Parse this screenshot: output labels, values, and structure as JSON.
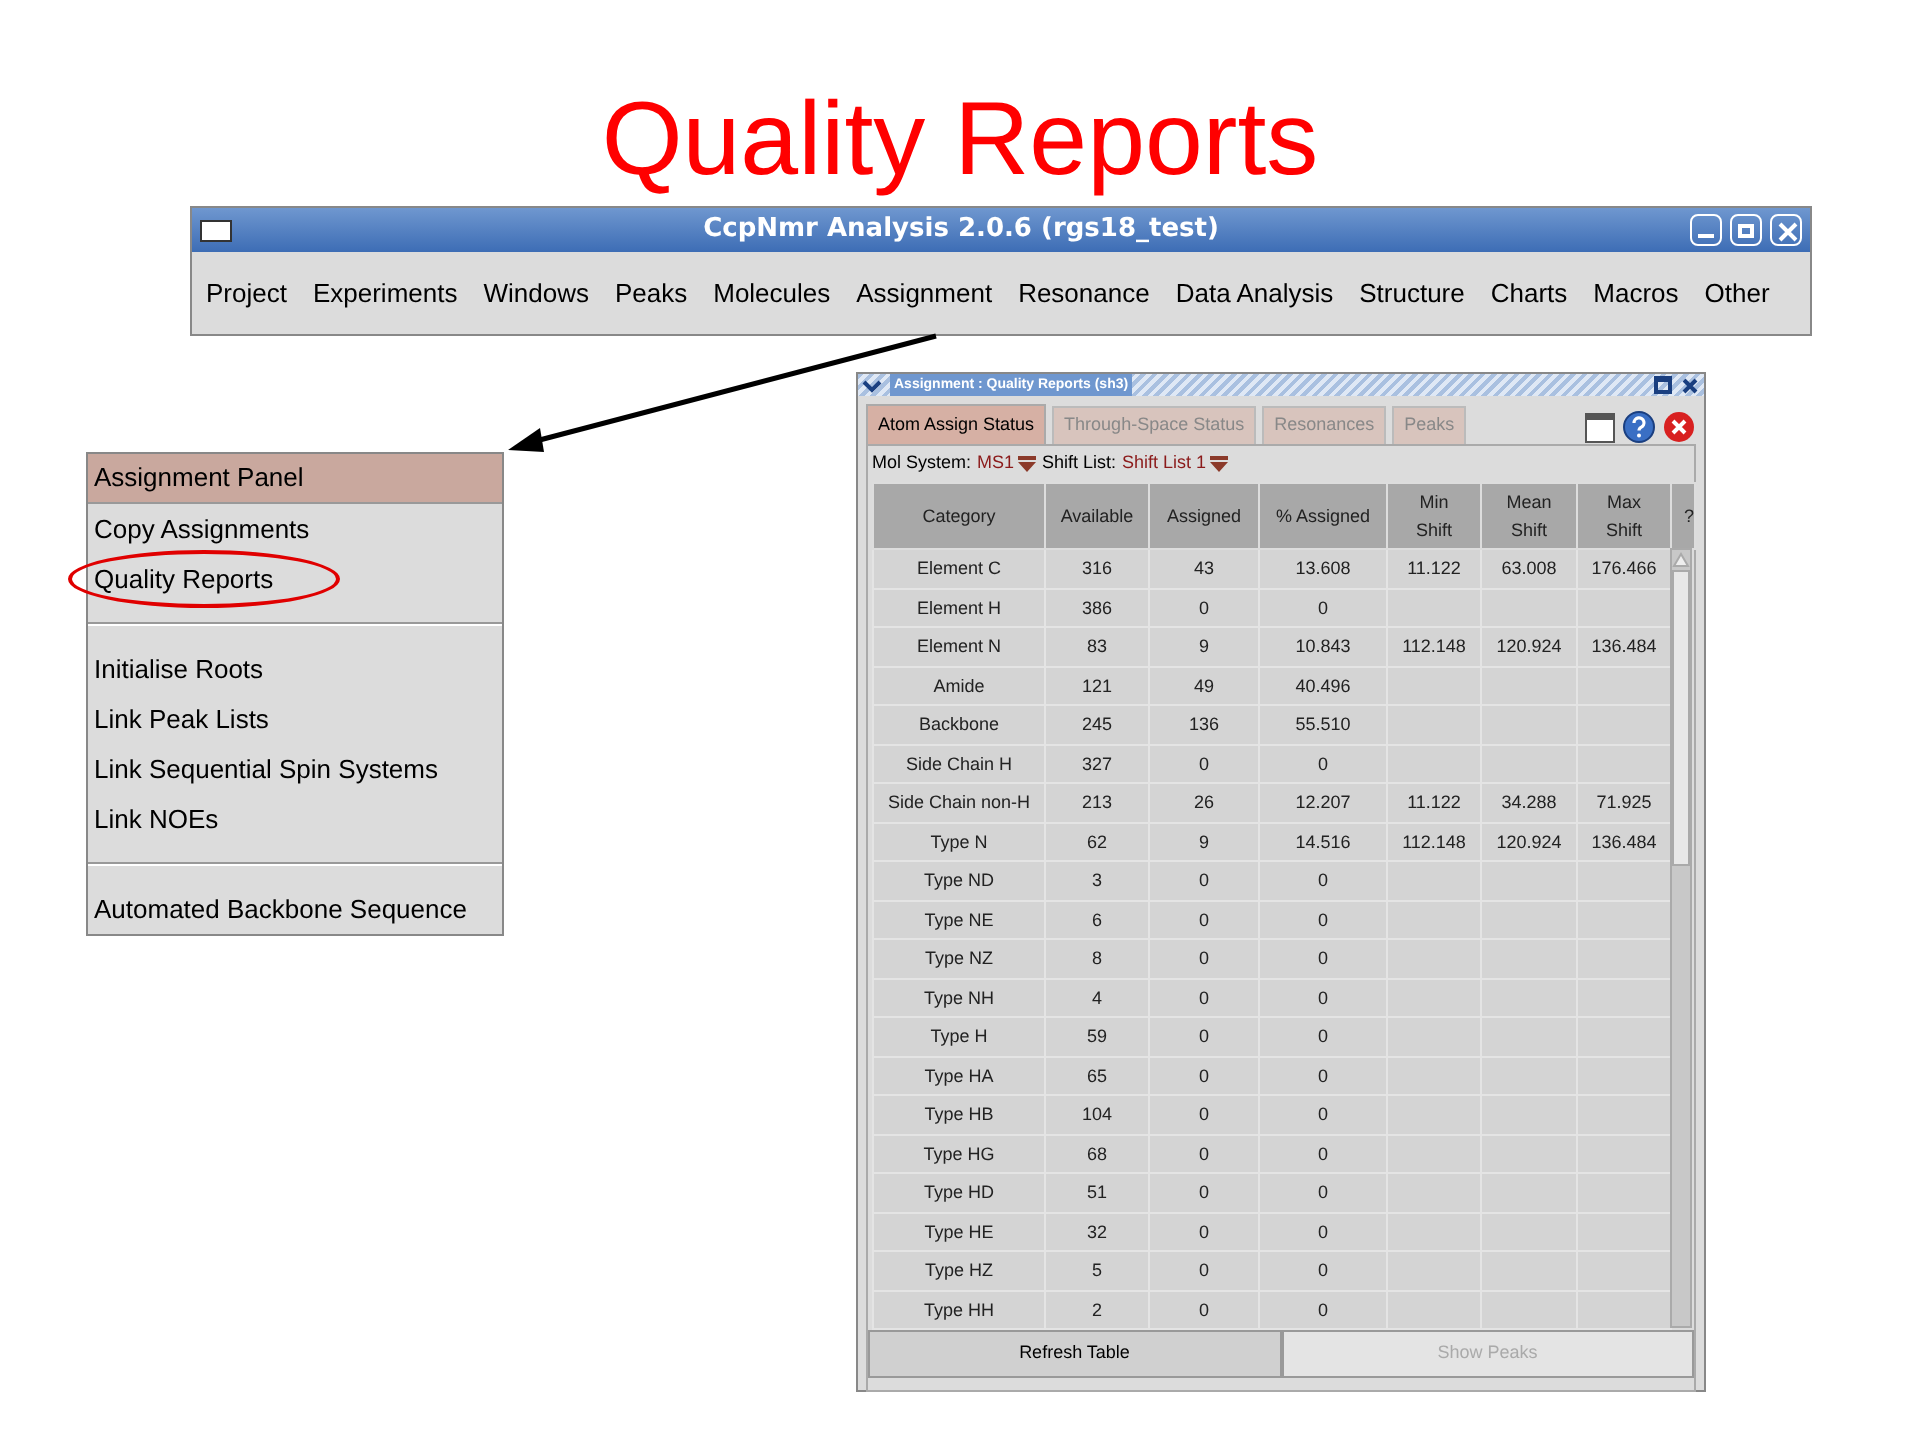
{
  "slide_title": "Quality Reports",
  "main_window": {
    "title": "CcpNmr Analysis 2.0.6 (rgs18_test)",
    "menu": [
      {
        "label": "Project"
      },
      {
        "label": "Experiments"
      },
      {
        "label": "Windows"
      },
      {
        "label": "Peaks"
      },
      {
        "label": "Molecules"
      },
      {
        "label": "Assignment"
      },
      {
        "label": "Resonance"
      },
      {
        "label": "Data Analysis"
      },
      {
        "label": "Structure"
      },
      {
        "label": "Charts"
      },
      {
        "label": "Macros"
      },
      {
        "label": "Other"
      }
    ]
  },
  "assignment_menu": [
    {
      "kind": "item",
      "label": "Assignment Panel",
      "selected": true,
      "circled": false
    },
    {
      "kind": "item",
      "label": "Copy Assignments",
      "selected": false,
      "circled": false
    },
    {
      "kind": "item",
      "label": "Quality Reports",
      "selected": false,
      "circled": true
    },
    {
      "kind": "separator"
    },
    {
      "kind": "item",
      "label": "Initialise Roots",
      "selected": false,
      "circled": false
    },
    {
      "kind": "item",
      "label": "Link Peak Lists",
      "selected": false,
      "circled": false
    },
    {
      "kind": "item",
      "label": "Link Sequential Spin Systems",
      "selected": false,
      "circled": false
    },
    {
      "kind": "item",
      "label": "Link NOEs",
      "selected": false,
      "circled": false
    },
    {
      "kind": "separator"
    },
    {
      "kind": "item",
      "label": "Automated Backbone Sequence",
      "selected": false,
      "circled": false
    }
  ],
  "dialog": {
    "title": "Assignment : Quality Reports (sh3)",
    "tabs": [
      {
        "label": "Atom Assign Status",
        "selected": true
      },
      {
        "label": "Through-Space Status",
        "selected": false
      },
      {
        "label": "Resonances",
        "selected": false
      },
      {
        "label": "Peaks",
        "selected": false
      }
    ],
    "mol_system_label": "Mol System:",
    "mol_system": "MS1",
    "shift_list_label": "Shift List:",
    "shift_list": "Shift List 1",
    "table": {
      "columns": [
        "Category",
        "Available",
        "Assigned",
        "% Assigned",
        "Min Shift",
        "Mean Shift",
        "Max Shift",
        "?"
      ],
      "rows": [
        [
          "Element C",
          "316",
          "43",
          "13.608",
          "11.122",
          "63.008",
          "176.466"
        ],
        [
          "Element H",
          "386",
          "0",
          "0",
          "",
          "",
          ""
        ],
        [
          "Element N",
          "83",
          "9",
          "10.843",
          "112.148",
          "120.924",
          "136.484"
        ],
        [
          "Amide",
          "121",
          "49",
          "40.496",
          "",
          "",
          ""
        ],
        [
          "Backbone",
          "245",
          "136",
          "55.510",
          "",
          "",
          ""
        ],
        [
          "Side Chain H",
          "327",
          "0",
          "0",
          "",
          "",
          ""
        ],
        [
          "Side Chain non-H",
          "213",
          "26",
          "12.207",
          "11.122",
          "34.288",
          "71.925"
        ],
        [
          "Type N",
          "62",
          "9",
          "14.516",
          "112.148",
          "120.924",
          "136.484"
        ],
        [
          "Type ND",
          "3",
          "0",
          "0",
          "",
          "",
          ""
        ],
        [
          "Type NE",
          "6",
          "0",
          "0",
          "",
          "",
          ""
        ],
        [
          "Type NZ",
          "8",
          "0",
          "0",
          "",
          "",
          ""
        ],
        [
          "Type NH",
          "4",
          "0",
          "0",
          "",
          "",
          ""
        ],
        [
          "Type H",
          "59",
          "0",
          "0",
          "",
          "",
          ""
        ],
        [
          "Type HA",
          "65",
          "0",
          "0",
          "",
          "",
          ""
        ],
        [
          "Type HB",
          "104",
          "0",
          "0",
          "",
          "",
          ""
        ],
        [
          "Type HG",
          "68",
          "0",
          "0",
          "",
          "",
          ""
        ],
        [
          "Type HD",
          "51",
          "0",
          "0",
          "",
          "",
          ""
        ],
        [
          "Type HE",
          "32",
          "0",
          "0",
          "",
          "",
          ""
        ],
        [
          "Type HZ",
          "5",
          "0",
          "0",
          "",
          "",
          ""
        ],
        [
          "Type HH",
          "2",
          "0",
          "0",
          "",
          "",
          ""
        ]
      ]
    },
    "buttons": [
      {
        "label": "Refresh Table",
        "disabled": false
      },
      {
        "label": "Show Peaks",
        "disabled": true
      }
    ]
  }
}
